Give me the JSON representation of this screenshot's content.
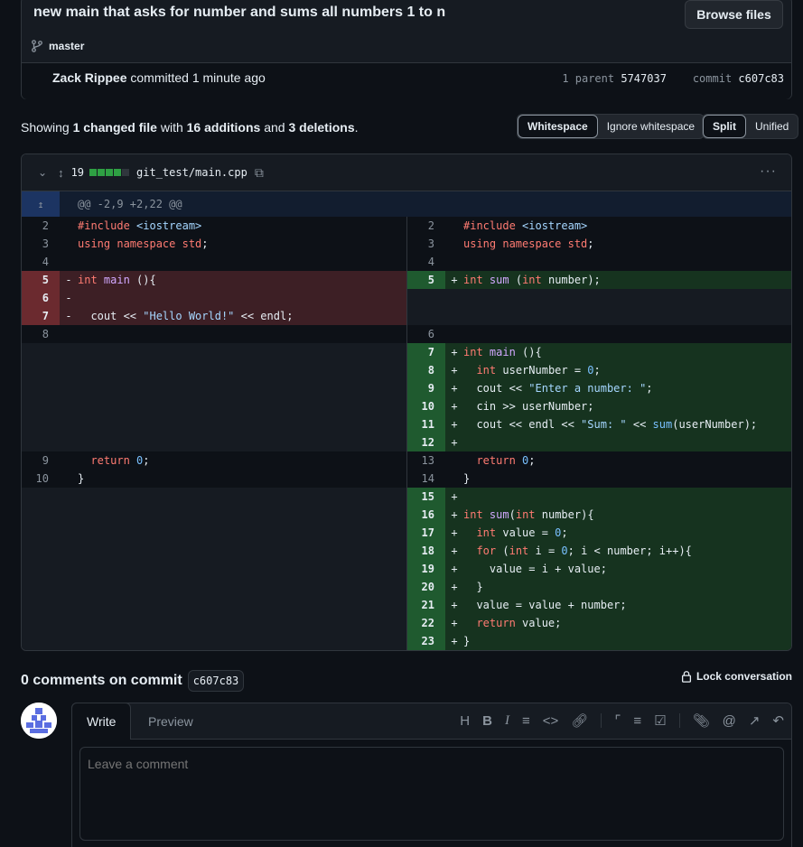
{
  "commit": {
    "title": "new main that asks for number and sums all numbers 1 to n",
    "browse_label": "Browse files",
    "branch": "master",
    "author": "Zack Rippee",
    "action": "committed 1 minute ago",
    "parent_label": "1 parent",
    "parent_hash": "5747037",
    "commit_label": "commit",
    "commit_hash": "c607c83"
  },
  "summary": {
    "prefix": "Showing",
    "changed": "1 changed file",
    "with": "with",
    "additions": "16 additions",
    "and": "and",
    "deletions": "3 deletions",
    "suffix": "."
  },
  "toggles": {
    "whitespace": "Whitespace",
    "ignore_whitespace": "Ignore whitespace",
    "split": "Split",
    "unified": "Unified"
  },
  "file": {
    "change_count": "19",
    "name": "git_test/main.cpp",
    "hunk": "@@ -2,9 +2,22 @@",
    "diffstat": [
      "add",
      "add",
      "add",
      "add",
      "del"
    ]
  },
  "comments": {
    "title": "0 comments on commit",
    "commit_hash": "c607c83",
    "lock_label": "Lock conversation",
    "write_tab": "Write",
    "preview_tab": "Preview",
    "placeholder": "Leave a comment"
  },
  "colors": {
    "background": "#0d1117",
    "addition": "#16331f",
    "deletion": "#3d1f25",
    "diffstat_add": "#2ea043",
    "diffstat_del": "#30363d"
  },
  "icons": [
    "branch-icon",
    "chevron-down-icon",
    "expand-icon",
    "copy-icon",
    "kebab-icon",
    "expand-up-icon",
    "lock-icon",
    "heading-icon",
    "bold-icon",
    "italic-icon",
    "quote-icon",
    "code-icon",
    "link-icon",
    "ordered-list-icon",
    "unordered-list-icon",
    "task-list-icon",
    "attach-icon",
    "mention-icon",
    "reference-icon",
    "undo-icon"
  ]
}
